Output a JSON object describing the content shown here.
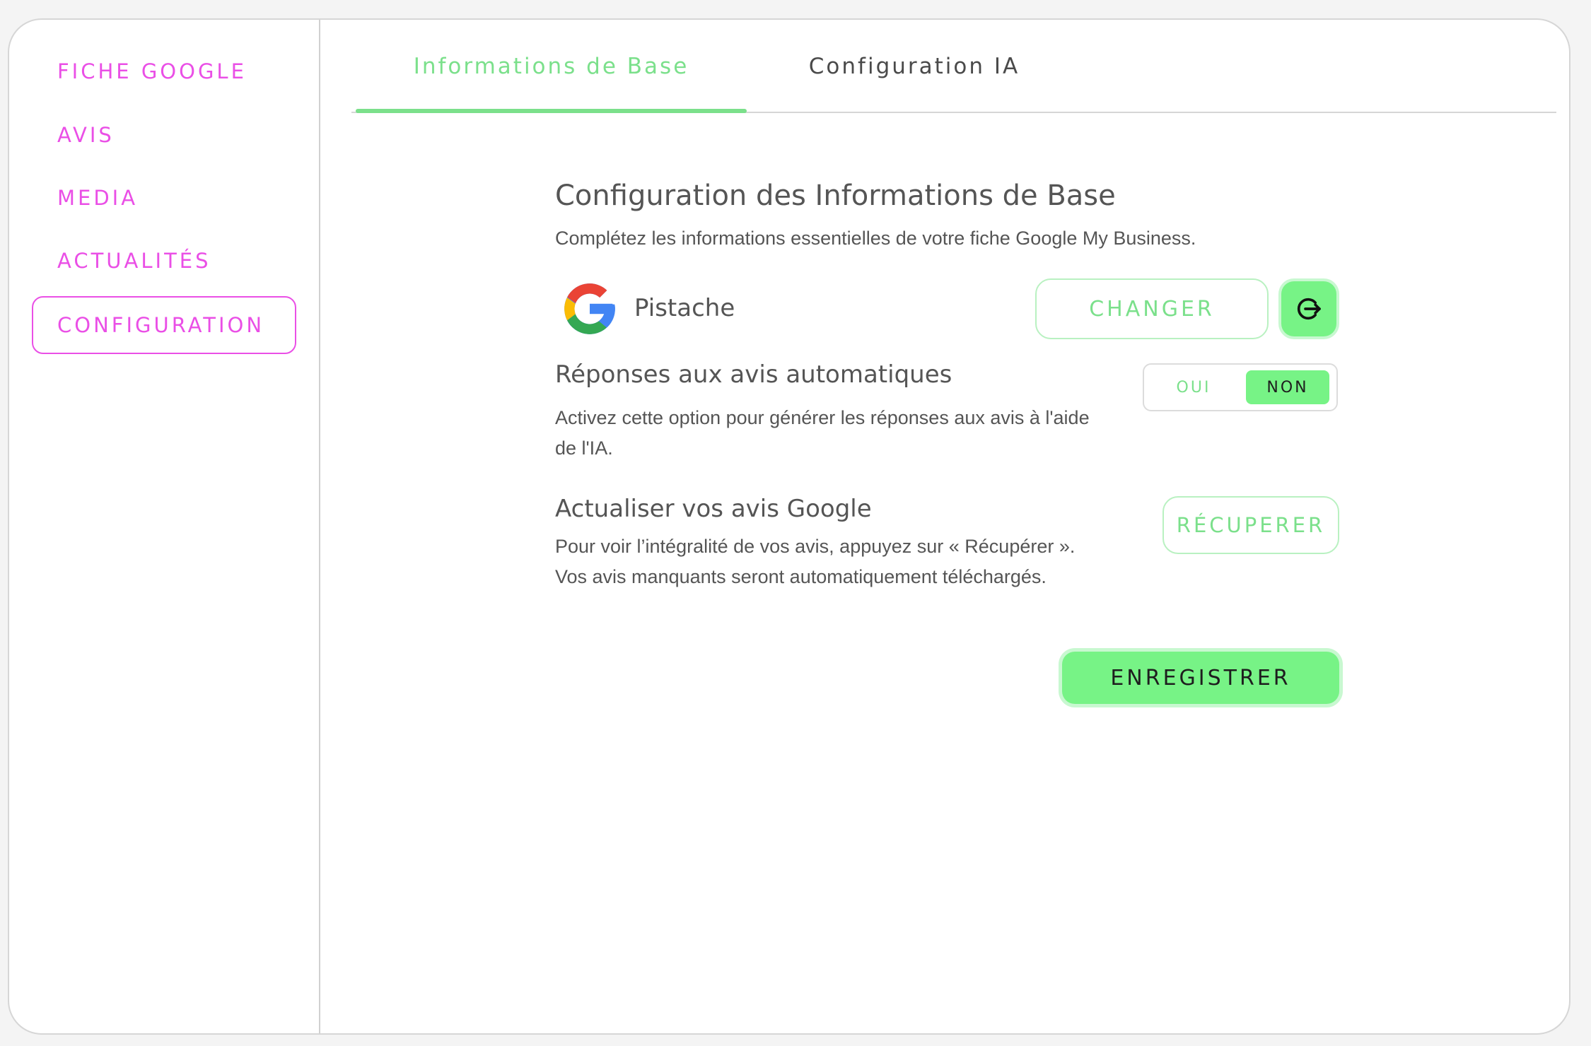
{
  "sidebar": {
    "items": [
      {
        "label": "FICHE GOOGLE"
      },
      {
        "label": "AVIS"
      },
      {
        "label": "MEDIA"
      },
      {
        "label": "ACTUALITÉS"
      },
      {
        "label": "CONFIGURATION",
        "active": true
      }
    ]
  },
  "tabs": [
    {
      "label": "Informations de Base",
      "active": true
    },
    {
      "label": "Configuration IA",
      "active": false
    }
  ],
  "main": {
    "title": "Configuration des Informations de Base",
    "subtitle": "Complétez les informations essentielles de votre fiche Google My Business.",
    "business": {
      "icon": "google-logo-icon",
      "name": "Pistache",
      "change_label": "CHANGER",
      "logout_icon": "logout-icon"
    },
    "auto_reply": {
      "title": "Réponses aux avis automatiques",
      "desc_line1": "Activez cette option pour générer les réponses aux avis à l'aide",
      "desc_line2": "de l'IA.",
      "options": [
        "OUI",
        "NON"
      ],
      "selected": "NON"
    },
    "refresh": {
      "title": "Actualiser vos avis Google",
      "desc_line1": "Pour voir l’intégralité de vos avis, appuyez sur « Récupérer ».",
      "desc_line2": "Vos avis manquants seront automatiquement téléchargés.",
      "button_label": "RÉCUPERER"
    },
    "save_label": "ENREGISTRER"
  },
  "colors": {
    "sidebar_accent": "#ea4fe6",
    "primary_green": "#77f386",
    "green_text": "#7be08b"
  }
}
